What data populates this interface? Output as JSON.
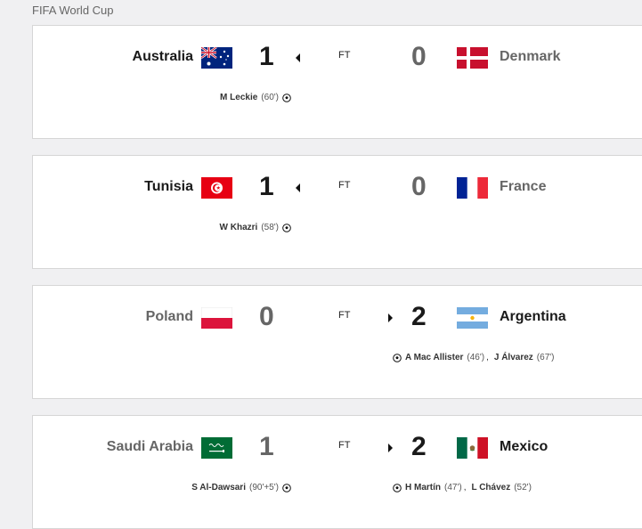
{
  "competition": "FIFA World Cup",
  "matches": [
    {
      "home": {
        "name": "Australia",
        "score": "1",
        "flag": "australia-flag",
        "won": true
      },
      "away": {
        "name": "Denmark",
        "score": "0",
        "flag": "denmark-flag",
        "won": false
      },
      "status": "FT",
      "winner_side": "home",
      "home_scorers": [
        {
          "name": "M Leckie",
          "minute": "(60')"
        }
      ],
      "away_scorers": []
    },
    {
      "home": {
        "name": "Tunisia",
        "score": "1",
        "flag": "tunisia-flag",
        "won": true
      },
      "away": {
        "name": "France",
        "score": "0",
        "flag": "france-flag",
        "won": false
      },
      "status": "FT",
      "winner_side": "home",
      "home_scorers": [
        {
          "name": "W Khazri",
          "minute": "(58')"
        }
      ],
      "away_scorers": []
    },
    {
      "home": {
        "name": "Poland",
        "score": "0",
        "flag": "poland-flag",
        "won": false
      },
      "away": {
        "name": "Argentina",
        "score": "2",
        "flag": "argentina-flag",
        "won": true
      },
      "status": "FT",
      "winner_side": "away",
      "home_scorers": [],
      "away_scorers": [
        {
          "name": "A Mac Allister",
          "minute": "(46')"
        },
        {
          "name": "J Álvarez",
          "minute": "(67')"
        }
      ]
    },
    {
      "home": {
        "name": "Saudi Arabia",
        "score": "1",
        "flag": "saudi-arabia-flag",
        "won": false
      },
      "away": {
        "name": "Mexico",
        "score": "2",
        "flag": "mexico-flag",
        "won": true
      },
      "status": "FT",
      "winner_side": "away",
      "home_scorers": [
        {
          "name": "S Al-Dawsari",
          "minute": "(90'+5')"
        }
      ],
      "away_scorers": [
        {
          "name": "H Martín",
          "minute": "(47')"
        },
        {
          "name": "L Chávez",
          "minute": "(52')"
        }
      ]
    }
  ],
  "separator": ",",
  "colors": {
    "winner_text": "#1a1a1a",
    "loser_text": "#666666",
    "card_border": "#d6d6d6",
    "background": "#f0f0f2"
  }
}
